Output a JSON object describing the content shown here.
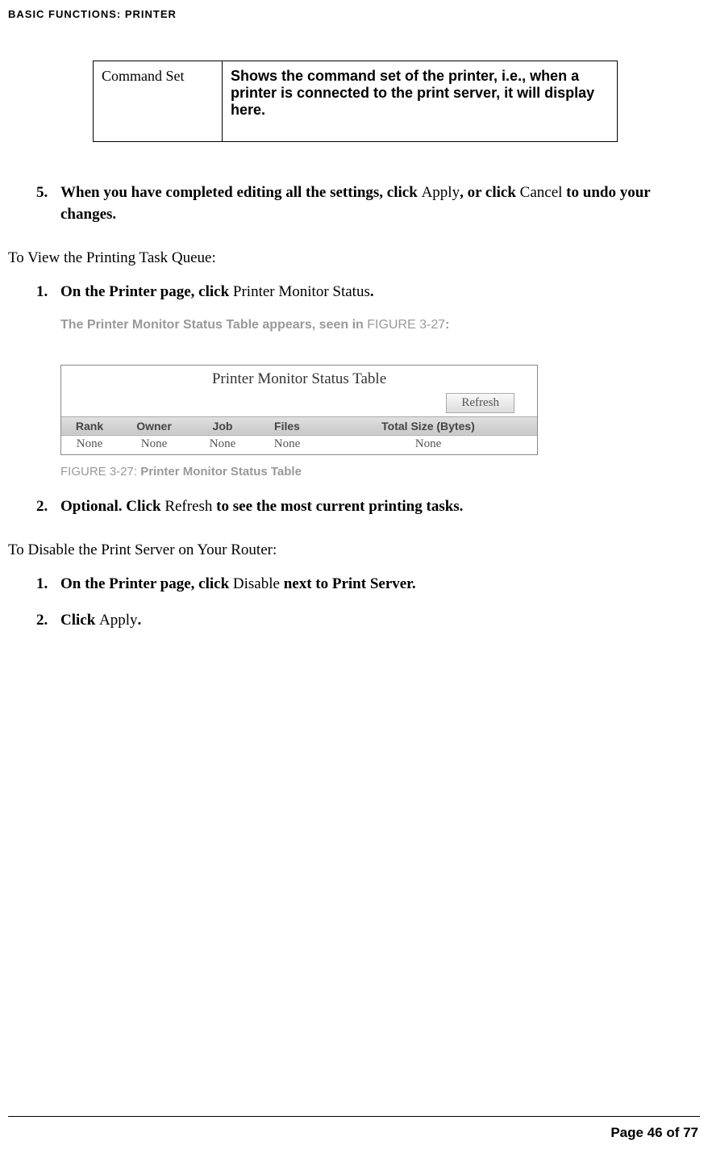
{
  "header": "BASIC FUNCTIONS: PRINTER",
  "cmd_table": {
    "left": "Command Set",
    "right": "Shows the command set of the printer, i.e., when a printer is connected to the print server, it will display here."
  },
  "step5": {
    "num": "5.",
    "b1": "When you have completed editing all the settings, click ",
    "apply": "Apply",
    "b2": ", or click ",
    "cancel": "Cancel",
    "b3": " to undo your changes."
  },
  "view_heading": "To View the Printing Task Queue:",
  "view1": {
    "num": "1.",
    "b1": "On the Printer page, click ",
    "link": "Printer Monitor Status",
    "b2": "."
  },
  "note": {
    "text": "The Printer Monitor Status Table appears, seen in ",
    "ref": "FIGURE 3-27",
    "colon": ":"
  },
  "screenshot": {
    "title": "Printer Monitor Status Table",
    "refresh": "Refresh",
    "headers": [
      "Rank",
      "Owner",
      "Job",
      "Files",
      "Total Size (Bytes)"
    ],
    "row": [
      "None",
      "None",
      "None",
      "None",
      "None"
    ]
  },
  "caption": {
    "label": "FIGURE 3-27: ",
    "title": "Printer Monitor Status Table"
  },
  "view2": {
    "num": "2.",
    "b1": "Optional. Click ",
    "link": "Refresh",
    "b2": " to see the most current printing tasks."
  },
  "disable_heading": "To Disable the Print Server on Your Router:",
  "dis1": {
    "num": "1.",
    "b1": "On the Printer page, click ",
    "link": "Disable",
    "b2": " next to Print Server."
  },
  "dis2": {
    "num": "2.",
    "b1": "Click ",
    "link": "Apply",
    "b2": "."
  },
  "footer": "Page 46 of 77"
}
